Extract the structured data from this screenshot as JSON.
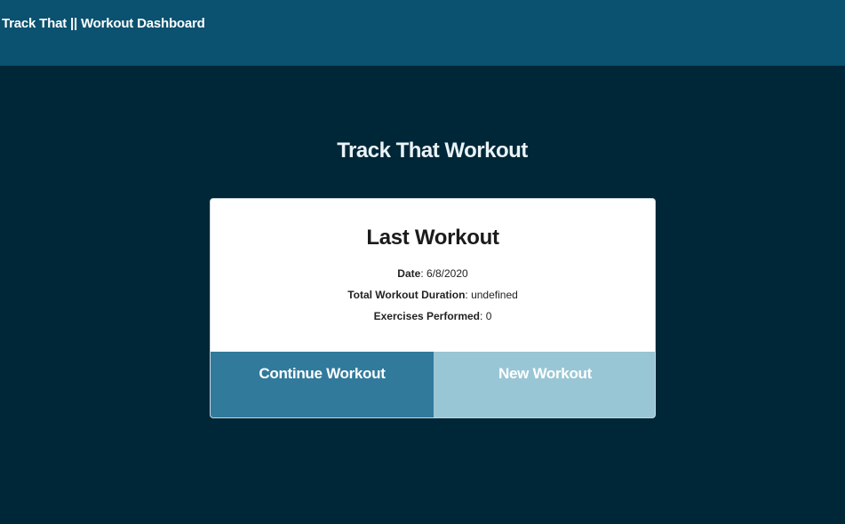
{
  "header": {
    "brand": "Track That || Workout Dashboard"
  },
  "main": {
    "heading": "Track That Workout"
  },
  "card": {
    "title": "Last Workout",
    "date_label": "Date",
    "date_value": "6/8/2020",
    "duration_label": "Total Workout Duration",
    "duration_value": "undefined",
    "exercises_label": "Exercises Performed",
    "exercises_value": "0"
  },
  "actions": {
    "continue_label": "Continue Workout",
    "new_label": "New Workout"
  },
  "colors": {
    "background": "#002737",
    "navbar": "#0b5170",
    "continue_button": "#317a9c",
    "new_button": "#98c6d5"
  }
}
